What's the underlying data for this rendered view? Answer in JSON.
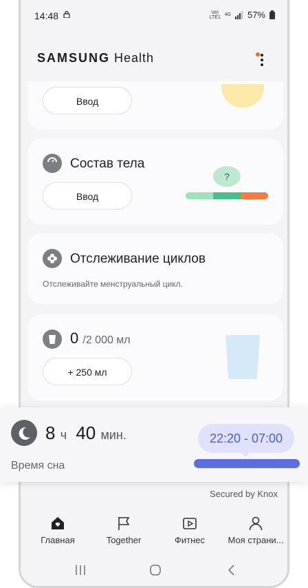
{
  "status": {
    "time": "14:48",
    "network": "4G",
    "volte": "Vo) LTE1",
    "battery": "57%"
  },
  "app": {
    "brand_bold": "SAMSUNG",
    "brand_rest": "Health"
  },
  "cards": {
    "top": {
      "button": "Ввод"
    },
    "body_comp": {
      "title": "Состав тела",
      "button": "Ввод",
      "badge": "?"
    },
    "cycle": {
      "title": "Отслеживание циклов",
      "subtitle": "Отслеживайте менструальный цикл."
    },
    "water": {
      "value": "0",
      "goal": "/2 000 мл",
      "button": "+  250 мл"
    }
  },
  "sleep": {
    "hours": "8",
    "hours_unit": "ч",
    "minutes": "40",
    "minutes_unit": "мин.",
    "label": "Время сна",
    "range": "22:20 - 07:00"
  },
  "secured": "Secured by Knox",
  "nav": [
    {
      "label": "Главная"
    },
    {
      "label": "Together"
    },
    {
      "label": "Фитнес"
    },
    {
      "label": "Моя страни..."
    }
  ],
  "colors": {
    "accent": "#5b6de0",
    "bubble": "#dfe2fa",
    "notif_dot": "#f26a2e",
    "water_glass": "#d6e9f8",
    "scale_green": "#46c08a",
    "scale_orange": "#f57c3d"
  }
}
